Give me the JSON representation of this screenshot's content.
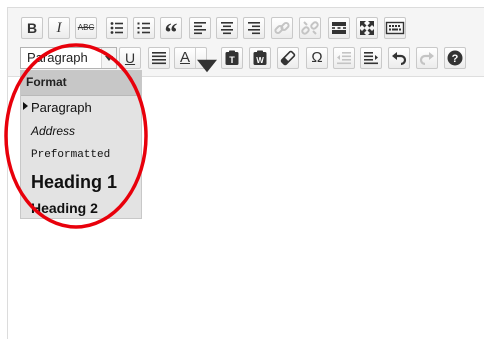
{
  "toolbar": {
    "row1": [
      {
        "id": "bold",
        "glyph": "B",
        "tip": "Bold"
      },
      {
        "id": "italic",
        "glyph": "I",
        "tip": "Italic"
      },
      {
        "id": "strikethrough",
        "glyph": "ABC",
        "tip": "Strikethrough"
      },
      {
        "id": "bullet-list",
        "glyph": "",
        "tip": "Bulleted list"
      },
      {
        "id": "numbered-list",
        "glyph": "",
        "tip": "Numbered list"
      },
      {
        "id": "blockquote",
        "glyph": "“",
        "tip": "Blockquote"
      },
      {
        "id": "align-left",
        "glyph": "",
        "tip": "Align left"
      },
      {
        "id": "align-center",
        "glyph": "",
        "tip": "Align center"
      },
      {
        "id": "align-right",
        "glyph": "",
        "tip": "Align right"
      },
      {
        "id": "insert-link",
        "glyph": "",
        "tip": "Insert link"
      },
      {
        "id": "remove-link",
        "glyph": "",
        "tip": "Remove link"
      },
      {
        "id": "read-more",
        "glyph": "",
        "tip": "Insert Read More tag"
      },
      {
        "id": "fullscreen",
        "glyph": "",
        "tip": "Fullscreen"
      },
      {
        "id": "toolbar-toggle",
        "glyph": "",
        "tip": "Toolbar Toggle"
      }
    ],
    "row2": [
      {
        "id": "underline",
        "glyph": "U",
        "tip": "Underline"
      },
      {
        "id": "justify",
        "glyph": "",
        "tip": "Justify"
      },
      {
        "id": "text-color",
        "glyph": "A",
        "tip": "Text color"
      },
      {
        "id": "paste-as-text",
        "glyph": "T",
        "tip": "Paste as text"
      },
      {
        "id": "paste-from-word",
        "glyph": "W",
        "tip": "Paste from Word"
      },
      {
        "id": "clear-formatting",
        "glyph": "",
        "tip": "Clear formatting"
      },
      {
        "id": "special-character",
        "glyph": "Ω",
        "tip": "Special character"
      },
      {
        "id": "decrease-indent",
        "glyph": "",
        "tip": "Decrease indent"
      },
      {
        "id": "increase-indent",
        "glyph": "",
        "tip": "Increase indent"
      },
      {
        "id": "undo",
        "glyph": "",
        "tip": "Undo"
      },
      {
        "id": "redo",
        "glyph": "",
        "tip": "Redo"
      },
      {
        "id": "help",
        "glyph": "?",
        "tip": "Keyboard Shortcuts"
      }
    ]
  },
  "format_select": {
    "value": "Paragraph"
  },
  "format_menu": {
    "header": "Format",
    "items": [
      {
        "label": "Paragraph",
        "checked": true
      },
      {
        "label": "Address"
      },
      {
        "label": "Preformatted"
      },
      {
        "label": "Heading 1"
      },
      {
        "label": "Heading 2"
      }
    ]
  },
  "colors": {
    "annotation": "#e8000b",
    "toolbar_bg": "#f5f5f5",
    "menu_bg": "#e3e3e3",
    "menu_header_bg": "#c7c7c7"
  },
  "annotation": {
    "shape": "ellipse",
    "color": "#e8000b"
  }
}
